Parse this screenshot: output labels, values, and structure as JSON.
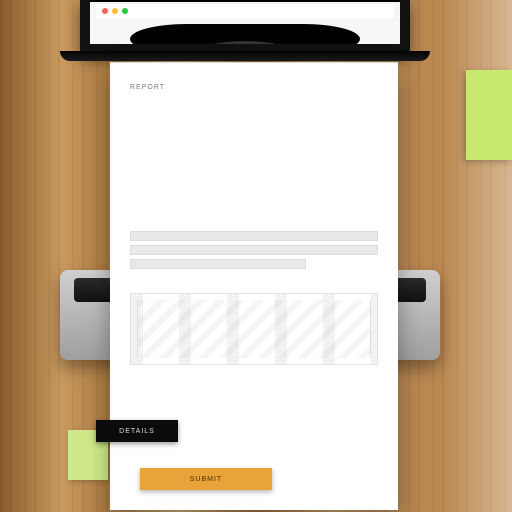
{
  "document": {
    "header_label": "REPORT",
    "section1_label": "",
    "section2_label": ""
  },
  "buttons": {
    "black_label": "DETAILS",
    "orange_label": "SUBMIT"
  }
}
